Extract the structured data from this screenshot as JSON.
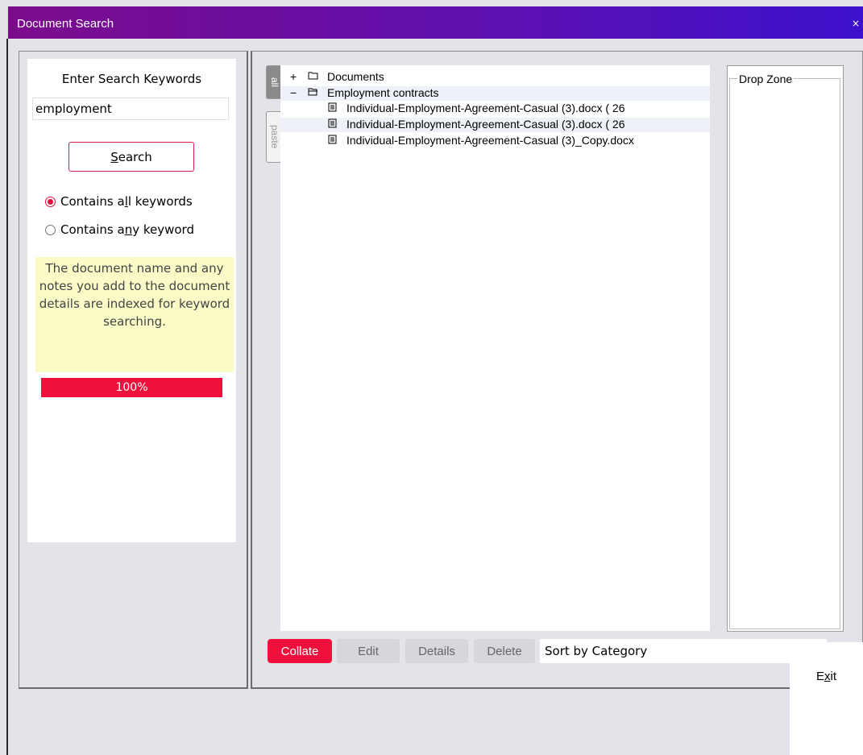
{
  "window": {
    "title": "Document Search",
    "close_glyph": "×"
  },
  "search": {
    "label": "Enter Search Keywords",
    "value": "employment",
    "button_prefix": "",
    "button_hotkey": "S",
    "button_rest": "earch",
    "options": [
      {
        "pre": "Contains a",
        "hotkey": "l",
        "post": "l keywords",
        "selected": true
      },
      {
        "pre": "Contains a",
        "hotkey": "n",
        "post": "y keyword",
        "selected": false
      }
    ],
    "note": "The document name and any notes you add to the document details are indexed for keyword searching.",
    "progress_label": "100%",
    "progress_value": 1.0
  },
  "tabs": {
    "all": "all",
    "paste": "paste"
  },
  "tree": {
    "root_expand": "+",
    "root_label": "Documents",
    "category_expand": "−",
    "category_label": "Employment contracts",
    "files": [
      "Individual-Employment-Agreement-Casual (3).docx   ( 26",
      "Individual-Employment-Agreement-Casual (3).docx   ( 26",
      "Individual-Employment-Agreement-Casual (3)_Copy.docx"
    ]
  },
  "dropzone": {
    "label": "Drop Zone"
  },
  "actions": {
    "collate": "Collate",
    "edit": "Edit",
    "details": "Details",
    "delete": "Delete",
    "sort_value": "Sort by Category"
  },
  "footer": {
    "exit_pre": "E",
    "exit_hotkey": "x",
    "exit_post": "it"
  },
  "colors": {
    "accent": "#f0103c",
    "title_start": "#7c0b8c",
    "title_end": "#3c10cc",
    "note_bg": "#fbfbc8"
  },
  "icons": {
    "folder_closed": "folder-icon",
    "folder_open": "folder-open-icon",
    "file": "document-icon",
    "close": "close-icon",
    "chevron": "chevron-down-icon"
  }
}
